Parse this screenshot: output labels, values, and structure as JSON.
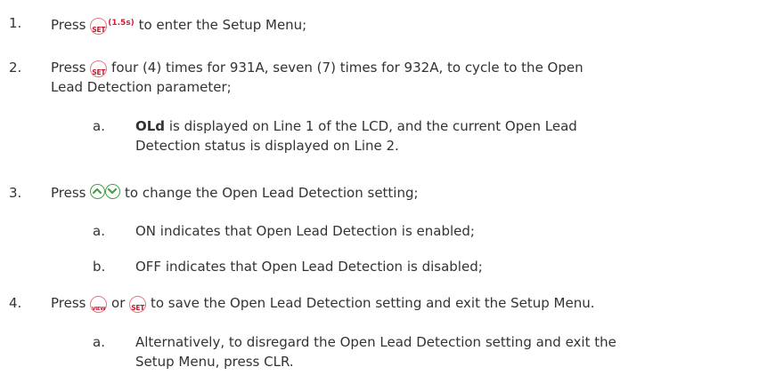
{
  "steps": [
    {
      "num": "1.",
      "before": "Press",
      "button": "SET",
      "hold": "(1.5s)",
      "after": "to enter the Setup Menu;"
    },
    {
      "num": "2.",
      "before": "Press",
      "button": "SET",
      "line1_after": "four (4) times for 931A, seven (7) times for 932A, to cycle to the Open",
      "line2": "Lead Detection parameter;",
      "sub": {
        "letter": "a.",
        "bold": "OLd",
        "line1_rest": "is displayed on Line 1 of the LCD, and the current Open Lead",
        "line2": "Detection status is displayed on Line 2."
      }
    },
    {
      "num": "3.",
      "before": "Press",
      "after": "to change the Open Lead Detection setting;",
      "subs": [
        {
          "letter": "a.",
          "text": "ON indicates that Open Lead Detection is enabled;"
        },
        {
          "letter": "b.",
          "text": "OFF indicates that Open Lead Detection is disabled;"
        }
      ]
    },
    {
      "num": "4.",
      "before": "Press",
      "view_button": "VIEW",
      "or": "or",
      "button": "SET",
      "after": "to save the Open Lead Detection setting and exit the Setup Menu.",
      "sub": {
        "letter": "a.",
        "line1": "Alternatively, to disregard the Open Lead Detection setting and exit the",
        "line2": "Setup Menu, press CLR."
      }
    }
  ],
  "icons": {
    "set_button": "set-button-icon",
    "view_button": "view-button-icon",
    "up_button": "up-arrow-button-icon",
    "down_button": "down-arrow-button-icon"
  },
  "colors": {
    "text": "#333333",
    "button_text": "#c0182a",
    "button_border": "#e07a80",
    "arrow_green": "#43a047"
  }
}
